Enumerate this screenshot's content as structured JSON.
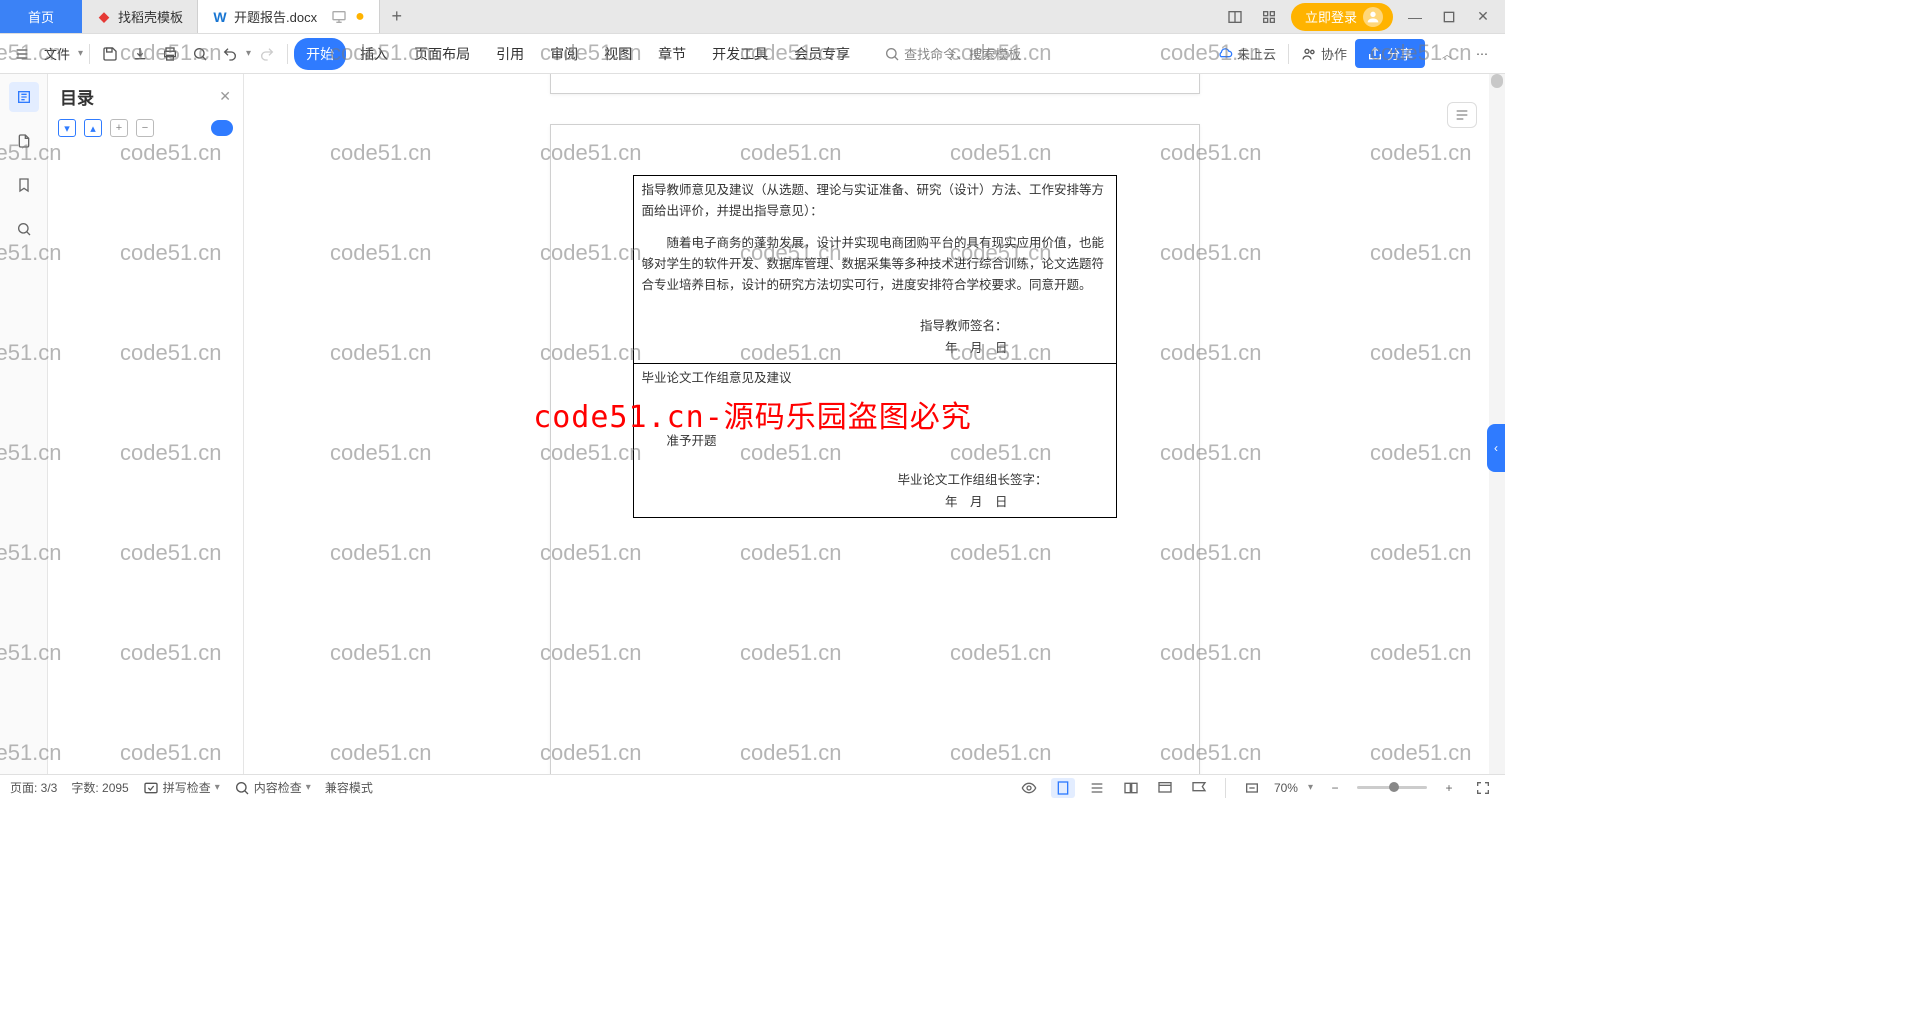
{
  "tabs": {
    "home": "首页",
    "template": "找稻壳模板",
    "active": "开题报告.docx"
  },
  "topRight": {
    "login": "立即登录"
  },
  "toolbar": {
    "file": "文件",
    "menu": [
      "开始",
      "插入",
      "页面布局",
      "引用",
      "审阅",
      "视图",
      "章节",
      "开发工具",
      "会员专享"
    ],
    "search": "查找命令、搜索模板",
    "cloud": "未上云",
    "collab": "协作",
    "share": "分享"
  },
  "outline": {
    "title": "目录"
  },
  "doc": {
    "cell1_header": "指导教师意见及建议（从选题、理论与实证准备、研究（设计）方法、工作安排等方面给出评价，并提出指导意见）：",
    "cell1_body": "随着电子商务的蓬勃发展，设计并实现电商团购平台的具有现实应用价值，也能够对学生的软件开发、数据库管理、数据采集等多种技术进行综合训练，论文选题符合专业培养目标，设计的研究方法切实可行，进度安排符合学校要求。同意开题。",
    "cell1_sig": "指导教师签名：",
    "cell1_date": "年　月　日",
    "cell2_header": "毕业论文工作组意见及建议",
    "cell2_body": "准予开题",
    "cell2_sig": "毕业论文工作组组长签字：",
    "cell2_date": "年　月　日"
  },
  "status": {
    "page": "页面: 3/3",
    "words": "字数: 2095",
    "spell": "拼写检查",
    "content": "内容检查",
    "compat": "兼容模式",
    "zoom": "70%"
  },
  "watermark": {
    "text": "code51.cn",
    "red": "code51.cn-源码乐园盗图必究"
  }
}
